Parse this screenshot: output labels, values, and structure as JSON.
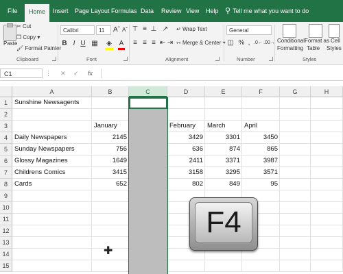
{
  "tabs": [
    "File",
    "Home",
    "Insert",
    "Page Layout",
    "Formulas",
    "Data",
    "Review",
    "View",
    "Help"
  ],
  "tell_me": "Tell me what you want to do",
  "clipboard": {
    "paste": "Paste",
    "cut": "Cut",
    "copy": "Copy",
    "format_painter": "Format Painter",
    "group": "Clipboard"
  },
  "font": {
    "name": "Calibri",
    "size": "11",
    "bold": "B",
    "italic": "I",
    "underline": "U",
    "group": "Font"
  },
  "alignment": {
    "wrap_text": "Wrap Text",
    "merge_center": "Merge & Center",
    "group": "Alignment"
  },
  "number": {
    "format": "General",
    "percent": "%",
    "comma": ",",
    "group": "Number"
  },
  "styles": {
    "conditional_formatting_1": "Conditional",
    "conditional_formatting_2": "Formatting",
    "format_as_table_1": "Format as",
    "format_as_table_2": "Table",
    "cell_styles_1": "Cell",
    "cell_styles_2": "Styles",
    "group": "Styles"
  },
  "formula_bar": {
    "name_box": "C1",
    "fx": "fx",
    "cancel": "✕",
    "enter": "✓"
  },
  "columns": [
    "A",
    "B",
    "C",
    "D",
    "E",
    "F",
    "G",
    "H"
  ],
  "rows": [
    "1",
    "2",
    "3",
    "4",
    "5",
    "6",
    "7",
    "8",
    "9",
    "10",
    "11",
    "12",
    "13",
    "14",
    "15"
  ],
  "sheet": {
    "title": "Sunshine Newsagents",
    "headers": {
      "b": "January",
      "d": "February",
      "e": "March",
      "f": "April"
    },
    "data": [
      {
        "label": "Daily Newspapers",
        "b": "2145",
        "d": "3429",
        "e": "3301",
        "f": "3450"
      },
      {
        "label": "Sunday Newspapers",
        "b": "756",
        "d": "636",
        "e": "874",
        "f": "865"
      },
      {
        "label": "Glossy Magazines",
        "b": "1649",
        "d": "2411",
        "e": "3371",
        "f": "3987"
      },
      {
        "label": "Childrens Comics",
        "b": "3415",
        "d": "3158",
        "e": "3295",
        "f": "3571"
      },
      {
        "label": "Cards",
        "b": "652",
        "d": "802",
        "e": "849",
        "f": "95"
      }
    ]
  },
  "overlay_key": "F4",
  "colors": {
    "accent": "#217346",
    "selection": "#bdbdbd"
  }
}
